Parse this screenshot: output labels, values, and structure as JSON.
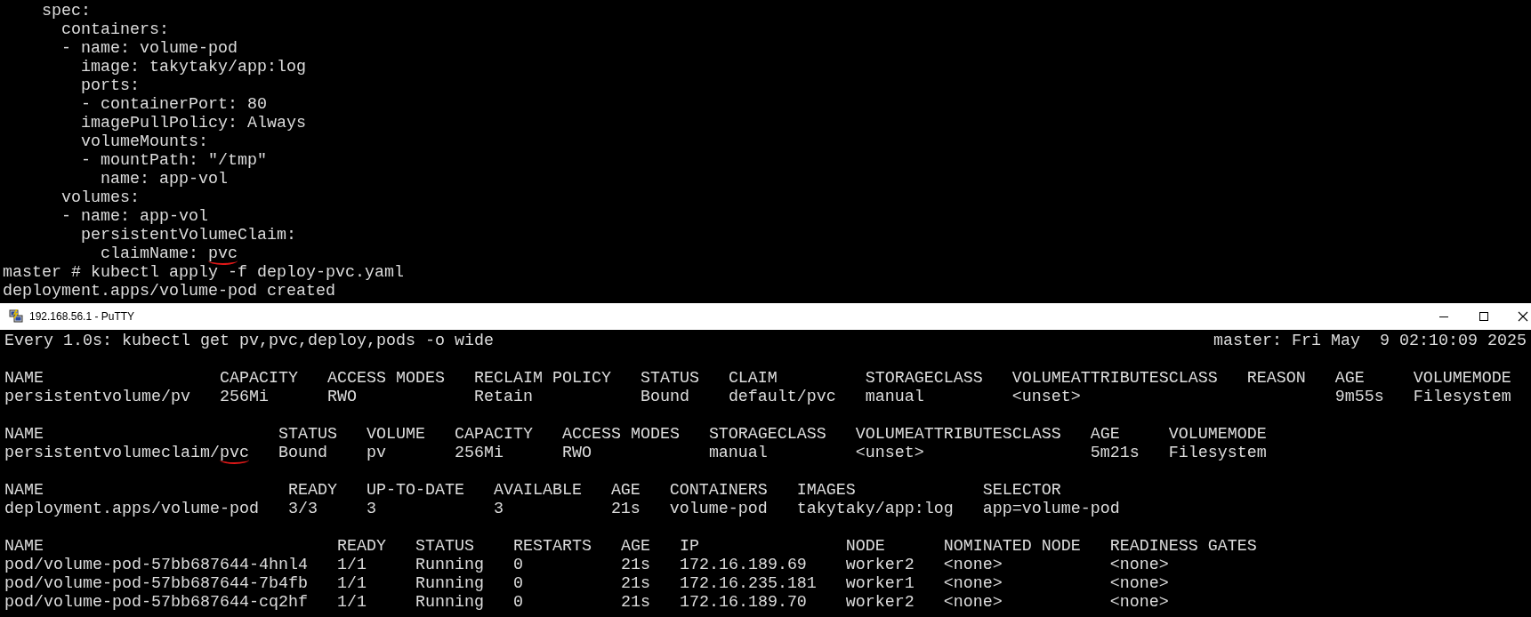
{
  "background_terminal": {
    "lines": [
      "    spec:",
      "      containers:",
      "      - name: volume-pod",
      "        image: takytaky/app:log",
      "        ports:",
      "        - containerPort: 80",
      "        imagePullPolicy: Always",
      "        volumeMounts:",
      "        - mountPath: \"/tmp\"",
      "          name: app-vol",
      "      volumes:",
      "      - name: app-vol",
      "        persistentVolumeClaim:",
      {
        "segments": [
          {
            "text": "          claimName: ",
            "red_underline": false
          },
          {
            "text": "pvc",
            "red_underline": true
          }
        ]
      },
      "master # kubectl apply -f deploy-pvc.yaml",
      "deployment.apps/volume-pod created"
    ]
  },
  "putty": {
    "title": "192.168.56.1 - PuTTY",
    "watch_command": "Every 1.0s: kubectl get pv,pvc,deploy,pods -o wide",
    "watch_status": "master: Fri May  9 02:10:09 2025",
    "tables": [
      {
        "columns": [
          "NAME",
          "CAPACITY",
          "ACCESS MODES",
          "RECLAIM POLICY",
          "STATUS",
          "CLAIM",
          "STORAGECLASS",
          "VOLUMEATTRIBUTESCLASS",
          "REASON",
          "AGE",
          "VOLUMEMODE"
        ],
        "rows": [
          [
            "persistentvolume/pv",
            "256Mi",
            "RWO",
            "Retain",
            "Bound",
            "default/pvc",
            "manual",
            "<unset>",
            null,
            "9m55s",
            "Filesystem"
          ]
        ]
      },
      {
        "columns": [
          "NAME",
          "STATUS",
          "VOLUME",
          "CAPACITY",
          "ACCESS MODES",
          "STORAGECLASS",
          "VOLUMEATTRIBUTESCLASS",
          "AGE",
          "VOLUMEMODE"
        ],
        "rows": [
          [
            {
              "segments": [
                {
                  "text": "persistentvolumeclaim/",
                  "red_underline": false
                },
                {
                  "text": "pvc",
                  "red_underline": true
                }
              ]
            },
            "Bound",
            "pv",
            "256Mi",
            "RWO",
            "manual",
            "<unset>",
            "5m21s",
            "Filesystem"
          ]
        ]
      },
      {
        "columns": [
          "NAME",
          "READY",
          "UP-TO-DATE",
          "AVAILABLE",
          "AGE",
          "CONTAINERS",
          "IMAGES",
          "SELECTOR"
        ],
        "rows": [
          [
            "deployment.apps/volume-pod",
            "3/3",
            "3",
            "3",
            "21s",
            "volume-pod",
            "takytaky/app:log",
            "app=volume-pod"
          ]
        ]
      },
      {
        "columns": [
          "NAME",
          "READY",
          "STATUS",
          "RESTARTS",
          "AGE",
          "IP",
          "NODE",
          "NOMINATED NODE",
          "READINESS GATES"
        ],
        "rows": [
          [
            "pod/volume-pod-57bb687644-4hnl4",
            "1/1",
            "Running",
            "0",
            "21s",
            "172.16.189.69",
            "worker2",
            "<none>",
            "<none>"
          ],
          [
            "pod/volume-pod-57bb687644-7b4fb",
            "1/1",
            "Running",
            "0",
            "21s",
            "172.16.235.181",
            "worker1",
            "<none>",
            "<none>"
          ],
          [
            "pod/volume-pod-57bb687644-cq2hf",
            "1/1",
            "Running",
            "0",
            "21s",
            "172.16.189.70",
            "worker2",
            "<none>",
            "<none>"
          ]
        ]
      }
    ]
  }
}
